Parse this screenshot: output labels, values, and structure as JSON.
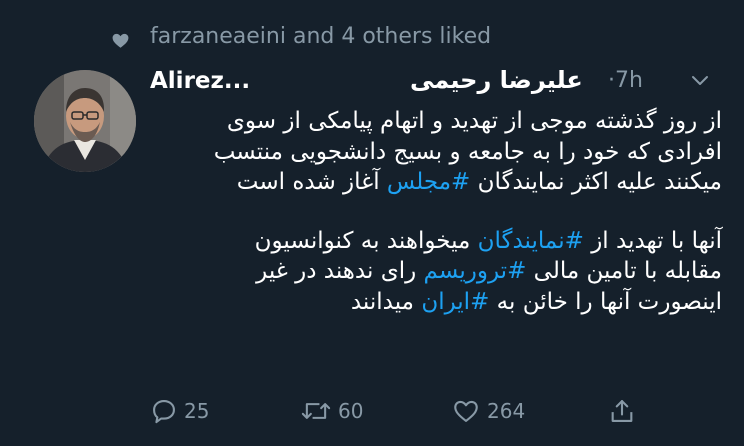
{
  "social_context": {
    "text": "farzaneaeini and 4 others liked",
    "icon": "heart-icon"
  },
  "tweet": {
    "display_name_latin": "Alirez...",
    "display_name_fa": "علیرضا رحیمی",
    "separator": "·",
    "time": "7h",
    "text_lines": {
      "l1": "از روز گذشته موجی از تهدید و اتهام پیامکی از سوی",
      "l2": "افرادی که خود را به جامعه و بسیج دانشجویی منتسب",
      "l3a": "میکنند علیه اکثر نمایندگان ",
      "l3_hashtag": "#مجلس",
      "l3b": " آغاز شده است",
      "l4a": "آنها با تهدید از ",
      "l4_hashtag": "#نمایندگان",
      "l4b": " میخواهند به کنوانسیون",
      "l5a": "مقابله با تامین مالی ",
      "l5_hashtag": "#تروریسم",
      "l5b": " رای ندهند در غیر",
      "l6a": "اینصورت آنها را خائن به ",
      "l6_hashtag": "#ایران",
      "l6b": " میدانند"
    }
  },
  "actions": {
    "reply_count": "25",
    "retweet_count": "60",
    "like_count": "264"
  },
  "colors": {
    "background": "#15202b",
    "text": "#ffffff",
    "muted": "#8899a6",
    "link": "#1da1f2"
  }
}
